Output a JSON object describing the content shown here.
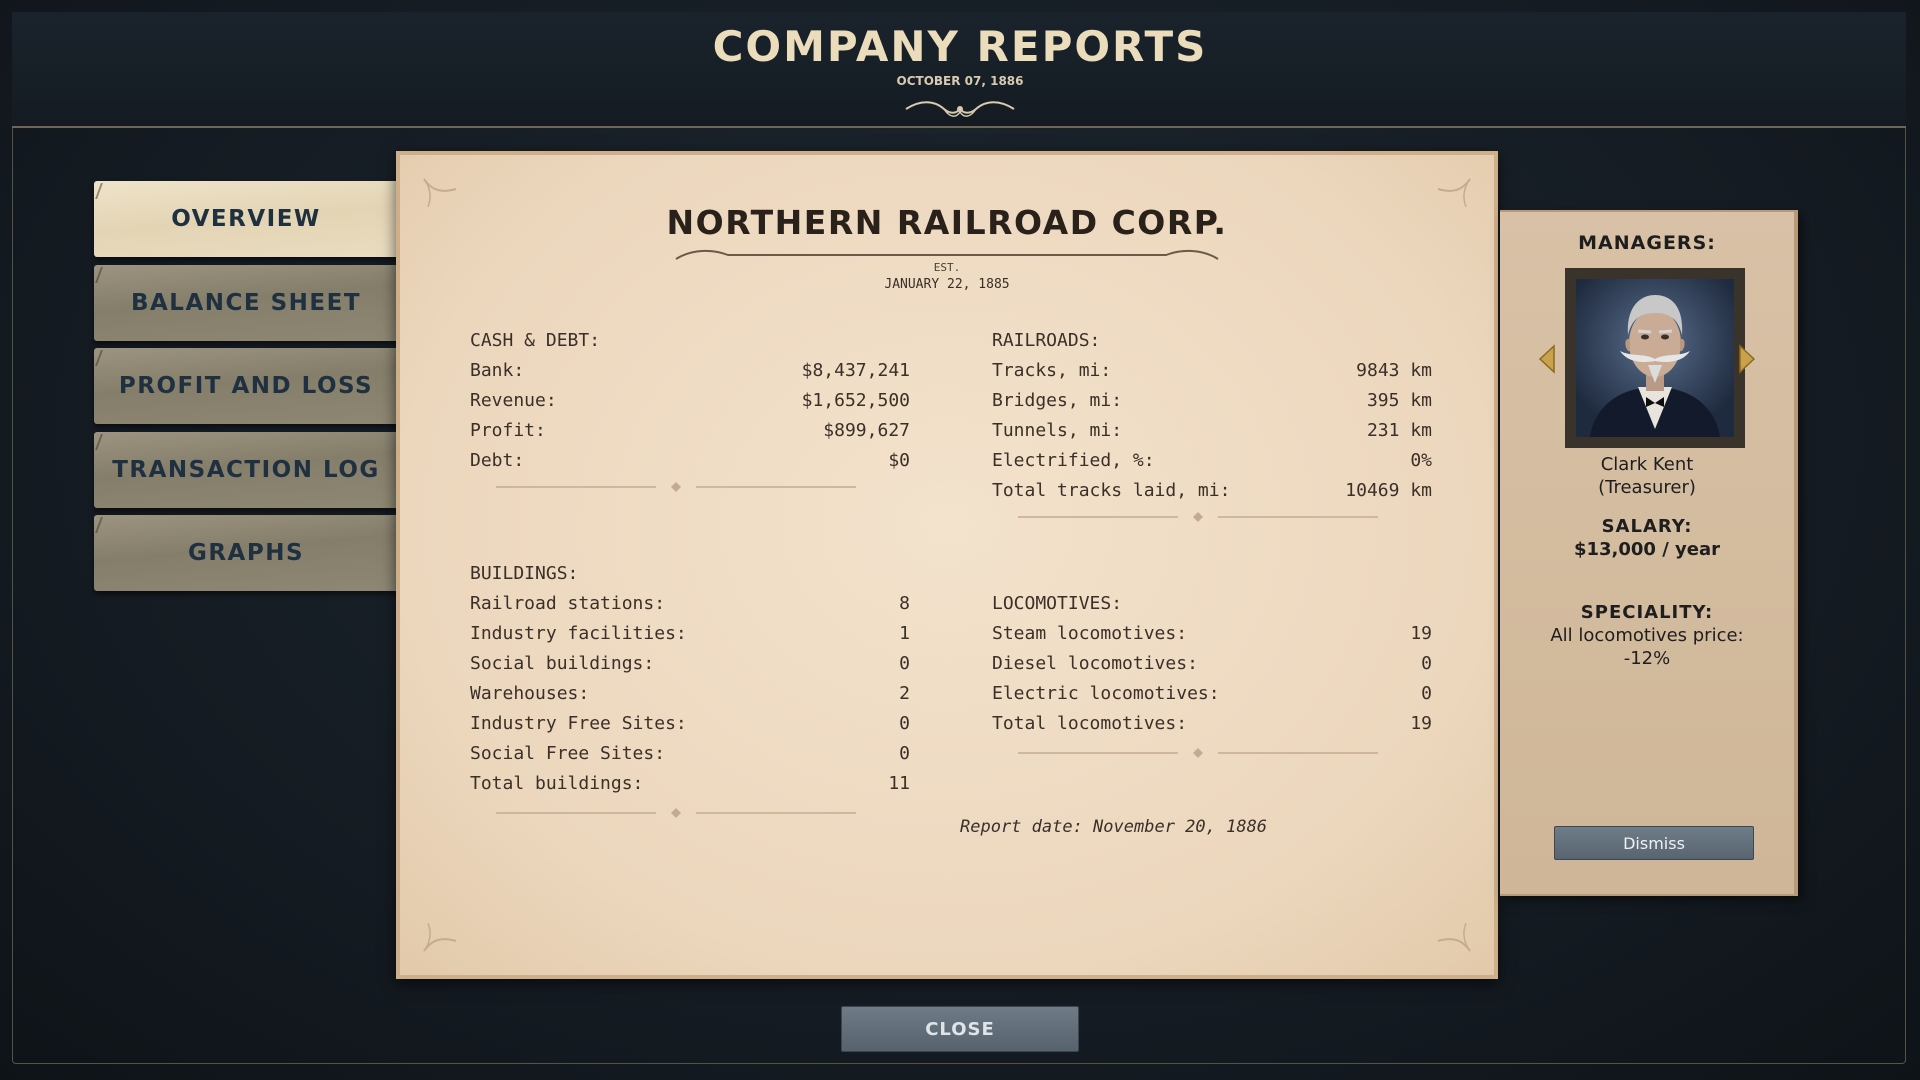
{
  "header": {
    "title": "COMPANY REPORTS",
    "date": "OCTOBER 07, 1886"
  },
  "nav": {
    "tabs": [
      {
        "label": "OVERVIEW",
        "active": true
      },
      {
        "label": "BALANCE SHEET",
        "active": false
      },
      {
        "label": "PROFIT AND LOSS",
        "active": false
      },
      {
        "label": "TRANSACTION LOG",
        "active": false
      },
      {
        "label": "GRAPHS",
        "active": false
      }
    ]
  },
  "report": {
    "company_name": "NORTHERN RAILROAD CORP.",
    "est_label": "EST.",
    "est_date": "JANUARY 22, 1885",
    "cash_debt": {
      "title": "CASH & DEBT:",
      "rows": [
        {
          "label": "Bank:",
          "value": "$8,437,241"
        },
        {
          "label": "Revenue:",
          "value": "$1,652,500"
        },
        {
          "label": "Profit:",
          "value": "$899,627"
        },
        {
          "label": "Debt:",
          "value": "$0"
        }
      ]
    },
    "railroads": {
      "title": "RAILROADS:",
      "rows": [
        {
          "label": "Tracks, mi:",
          "value": "9843 km"
        },
        {
          "label": "Bridges, mi:",
          "value": "395 km"
        },
        {
          "label": "Tunnels, mi:",
          "value": "231 km"
        },
        {
          "label": "Electrified, %:",
          "value": "0%"
        },
        {
          "label": "Total tracks laid, mi:",
          "value": "10469 km"
        }
      ]
    },
    "buildings": {
      "title": "BUILDINGS:",
      "rows": [
        {
          "label": "Railroad stations:",
          "value": "8"
        },
        {
          "label": "Industry facilities:",
          "value": "1"
        },
        {
          "label": "Social buildings:",
          "value": "0"
        },
        {
          "label": "Warehouses:",
          "value": "2"
        },
        {
          "label": "Industry Free Sites:",
          "value": "0"
        },
        {
          "label": "Social Free Sites:",
          "value": "0"
        },
        {
          "label": "Total buildings:",
          "value": "11"
        }
      ]
    },
    "locomotives": {
      "title": "LOCOMOTIVES:",
      "rows": [
        {
          "label": "Steam locomotives:",
          "value": "19"
        },
        {
          "label": "Diesel locomotives:",
          "value": "0"
        },
        {
          "label": "Electric locomotives:",
          "value": "0"
        },
        {
          "label": "Total locomotives:",
          "value": "19"
        }
      ]
    },
    "report_date": "Report date: November 20, 1886"
  },
  "managers": {
    "title": "MANAGERS:",
    "name": "Clark Kent",
    "role": "(Treasurer)",
    "salary_label": "SALARY:",
    "salary_value": "$13,000 / year",
    "speciality_label": "SPECIALITY:",
    "speciality_value_1": "All locomotives price:",
    "speciality_value_2": "-12%",
    "dismiss_label": "Dismiss",
    "portrait_icon": "manager-portrait",
    "prev_icon": "arrow-left-icon",
    "next_icon": "arrow-right-icon"
  },
  "footer": {
    "close_label": "CLOSE"
  },
  "colors": {
    "background": "#151c23",
    "paper": "#efdcc4",
    "tab_active": "#e9dbbd",
    "tab_inactive": "#8e8773",
    "button": "#626f7a",
    "title_text": "#ebdcbc"
  }
}
